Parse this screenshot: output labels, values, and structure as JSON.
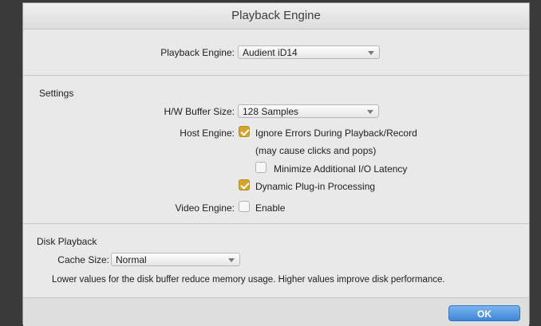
{
  "window": {
    "title": "Playback Engine"
  },
  "engine": {
    "label": "Playback Engine:",
    "value": "Audient iD14"
  },
  "settings": {
    "title": "Settings",
    "buffer": {
      "label": "H/W Buffer Size:",
      "value": "128 Samples"
    },
    "host_engine": {
      "label": "Host Engine:",
      "ignore_errors": {
        "label": "Ignore Errors During Playback/Record",
        "checked": true
      },
      "ignore_errors_note": "(may cause clicks and pops)",
      "minimize_latency": {
        "label": "Minimize Additional I/O Latency",
        "checked": false
      },
      "dynamic_plugin": {
        "label": "Dynamic Plug-in Processing",
        "checked": true
      }
    },
    "video_engine": {
      "label": "Video Engine:",
      "enable": {
        "label": "Enable",
        "checked": false
      }
    }
  },
  "disk": {
    "title": "Disk Playback",
    "cache": {
      "label": "Cache Size:",
      "value": "Normal"
    },
    "description": "Lower values for the disk buffer reduce memory usage.  Higher values improve disk performance."
  },
  "footer": {
    "ok_label": "OK"
  },
  "colors": {
    "checkbox_on": "#d4a52a",
    "ok_button": "#3f86d8"
  }
}
